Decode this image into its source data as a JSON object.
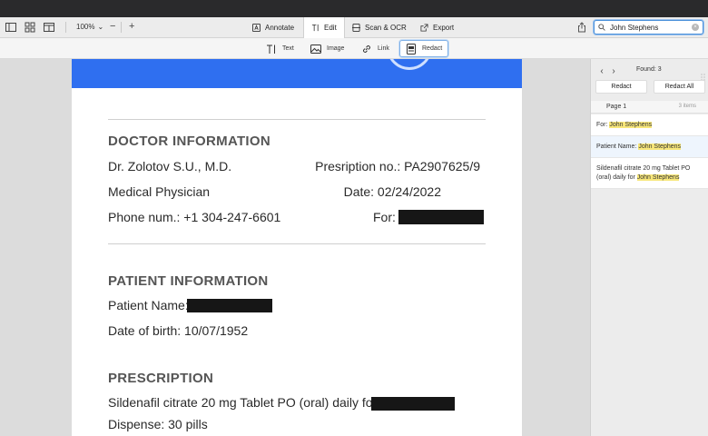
{
  "toolbar": {
    "zoom": "100%",
    "zoom_chevron": "⌄",
    "zoom_minus": "−",
    "zoom_plus": "+",
    "tabs": [
      {
        "label": "Annotate",
        "icon": "annotate-icon"
      },
      {
        "label": "Edit",
        "icon": "edit-text-icon"
      },
      {
        "label": "Scan & OCR",
        "icon": "scan-icon"
      },
      {
        "label": "Export",
        "icon": "export-icon"
      }
    ],
    "active_tab": "Edit",
    "search_value": "John Stephens"
  },
  "subtoolbar": {
    "tools": [
      {
        "label": "Text",
        "icon": "text-tool-icon"
      },
      {
        "label": "Image",
        "icon": "image-tool-icon"
      },
      {
        "label": "Link",
        "icon": "link-tool-icon"
      },
      {
        "label": "Redact",
        "icon": "redact-tool-icon"
      }
    ],
    "active_tool": "Redact"
  },
  "document": {
    "doctor_title": "DOCTOR INFORMATION",
    "doctor_name": "Dr. Zolotov S.U., M.D.",
    "prescription_no": "Presription no.: PA2907625/9",
    "specialty": "Medical Physician",
    "date": "Date: 02/24/2022",
    "phone": "Phone num.: +1 304-247-6601",
    "for_label": "For:",
    "patient_title": "PATIENT INFORMATION",
    "patient_name_label": "Patient Name:",
    "dob": "Date of birth: 10/07/1952",
    "prescription_title": "PRESCRIPTION",
    "rx_line": "Sildenafil citrate 20 mg Tablet PO (oral) daily for",
    "dispense": "Dispense: 30 pills"
  },
  "panel": {
    "found": "Found: 3",
    "redact_label": "Redact",
    "redact_all_label": "Redact All",
    "page_label": "Page 1",
    "items_count": "3 items",
    "results": [
      {
        "prefix": "For: ",
        "match": "John Stephens"
      },
      {
        "prefix": "Patient Name: ",
        "match": "John Stephens"
      },
      {
        "prefix": "Sildenafil citrate 20 mg Tablet PO (oral) daily for ",
        "match": "John Stephens"
      }
    ]
  },
  "colors": {
    "accent": "#2f6ff0",
    "highlight": "#f8e77a",
    "redaction": "#161616"
  }
}
